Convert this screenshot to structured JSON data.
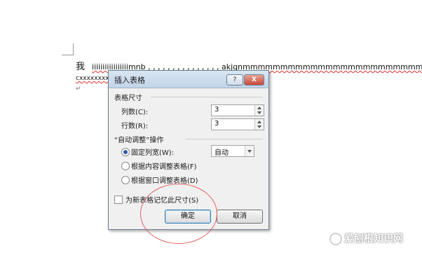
{
  "document": {
    "char": "我",
    "line1_text": "iiiiiiiiiiiiiiiiimnb , , , , , , , , , , , , , , ,  akjgnmmmmmmmmmmmmmmmmmmmmmmmm",
    "line2_text": "cxxxxxxxx",
    "para_mark": "↵"
  },
  "dialog": {
    "title": "插入表格",
    "help_label": "?",
    "close_label": "X",
    "table_size": {
      "title": "表格尺寸",
      "columns_label": "列数(C):",
      "columns_value": "3",
      "rows_label": "行数(R):",
      "rows_value": "3"
    },
    "autofit": {
      "title": "“自动调整”操作",
      "fixed_label": "固定列宽(W):",
      "fixed_value": "自动",
      "content_label": "根据内容调整表格(F)",
      "window_label": "根据窗口调整表格(D)"
    },
    "remember_label": "为新表格记忆此尺寸(S)",
    "ok_label": "确定",
    "cancel_label": "取消"
  },
  "watermark": {
    "text": "爱刨根知识网"
  },
  "colors": {
    "highlight_circle": "#e26060",
    "spell_underline": "#e03030",
    "radio_selected": "#2a5db0"
  }
}
